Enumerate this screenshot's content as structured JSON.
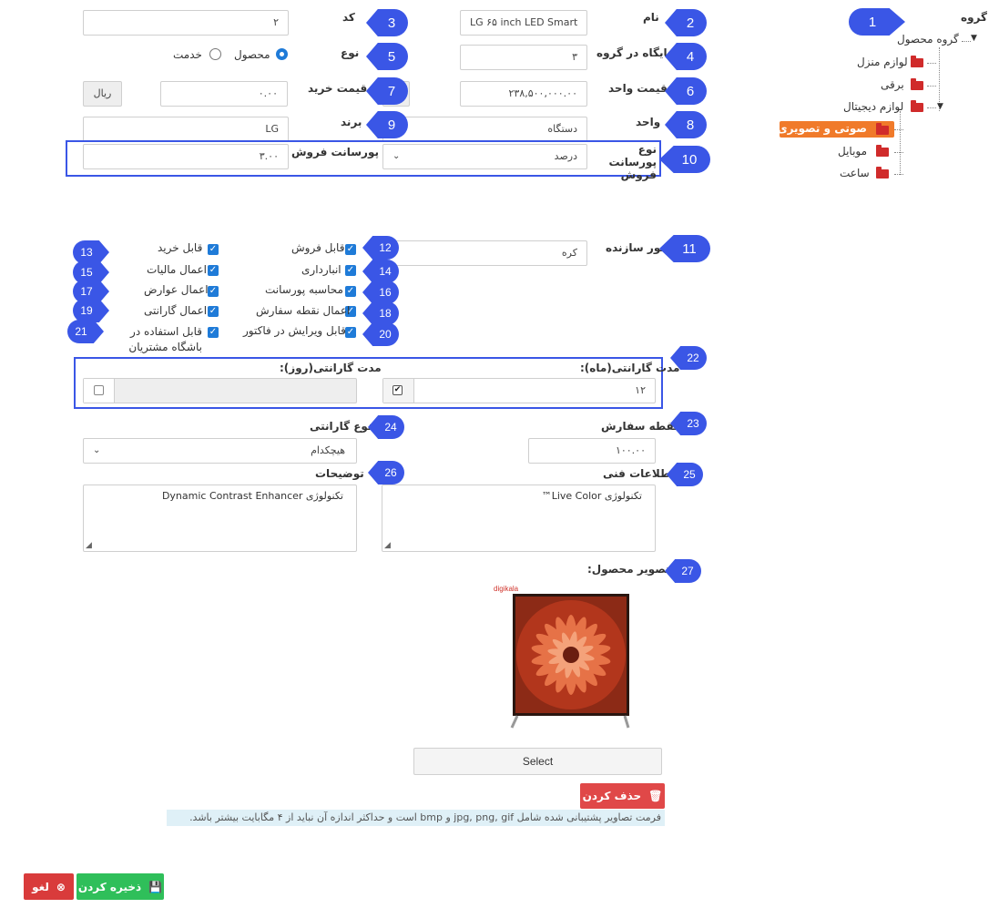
{
  "tree": {
    "header": "گروه",
    "root": "گروه محصول",
    "items": [
      "لوازم منزل",
      "برقی",
      "لوازم دیجیتال"
    ],
    "selected": "صوتی و تصویری",
    "sub_items": [
      "موبایل",
      "ساعت"
    ]
  },
  "form": {
    "name_label": "نام",
    "name_value": "LG ۶۵ inch LED Smart",
    "code_label": "کد",
    "code_value": "۲",
    "position_label": "جایگاه در گروه",
    "position_value": "۳",
    "type_label": "نوع",
    "type_product": "محصول",
    "type_service": "خدمت",
    "unit_price_label": "قیمت واحد",
    "unit_price_value": "۲۳۸,۵۰۰,۰۰۰.۰۰",
    "buy_price_label": "قیمت خرید",
    "buy_price_value": "۰.۰۰",
    "currency": "ریال",
    "unit_label": "واحد",
    "unit_value": "دستگاه",
    "brand_label": "برند",
    "brand_value": "LG",
    "commission_type_label": "نوع پورسانت فروش",
    "commission_type_value": "درصد",
    "commission_label": "پورسانت فروش",
    "commission_value": "۳.۰۰",
    "country_label": "کشور سازنده",
    "country_value": "کره",
    "checks": {
      "sellable": "قابل فروش",
      "buyable": "قابل خرید",
      "inventory": "انبارداری",
      "tax": "اعمال مالیات",
      "commission_calc": "محاسبه پورسانت",
      "duties": "اعمال عوارض",
      "order_point": "اعمال نقطه سفارش",
      "warranty": "اعمال گارانتی",
      "editable_invoice": "قابل ویرایش در فاکتور",
      "club": "قابل استفاده در باشگاه مشتریان"
    },
    "warranty_month_label": "مدت گارانتی(ماه):",
    "warranty_month_value": "۱۲",
    "warranty_day_label": "مدت گارانتی(روز):",
    "order_point_label": "نقطه سفارش",
    "order_point_value": "۱۰۰.۰۰",
    "warranty_type_label": "نوع گارانتی",
    "warranty_type_value": "هیچکدام",
    "tech_info_label": "اطلاعات فنی",
    "tech_info_value": "تکنولوژی Live Color™",
    "description_label": "توضیحات",
    "description_value": "تکنولوژی Dynamic Contrast Enhancer",
    "image_label": "تصویر محصول:",
    "image_brand": "digikala"
  },
  "buttons": {
    "select": "Select",
    "delete": "حذف کردن",
    "save": "ذخیره کردن",
    "cancel": "لغو"
  },
  "hint": "فرمت تصاویر پشتیبانی شده شامل jpg, png, gif و bmp است و حداکثر اندازه آن نباید از ۴ مگابایت بیشتر باشد.",
  "badges": [
    "1",
    "2",
    "3",
    "4",
    "5",
    "6",
    "7",
    "8",
    "9",
    "10",
    "11",
    "12",
    "13",
    "14",
    "15",
    "16",
    "17",
    "18",
    "19",
    "20",
    "21",
    "22",
    "23",
    "24",
    "25",
    "26",
    "27"
  ],
  "colors": {
    "badge": "#3a56e6",
    "checkbox": "#1f7bd8",
    "selected_tree": "#f07a2a",
    "delete": "#e04848",
    "save": "#2fbf5a",
    "cancel": "#d93b3b"
  }
}
